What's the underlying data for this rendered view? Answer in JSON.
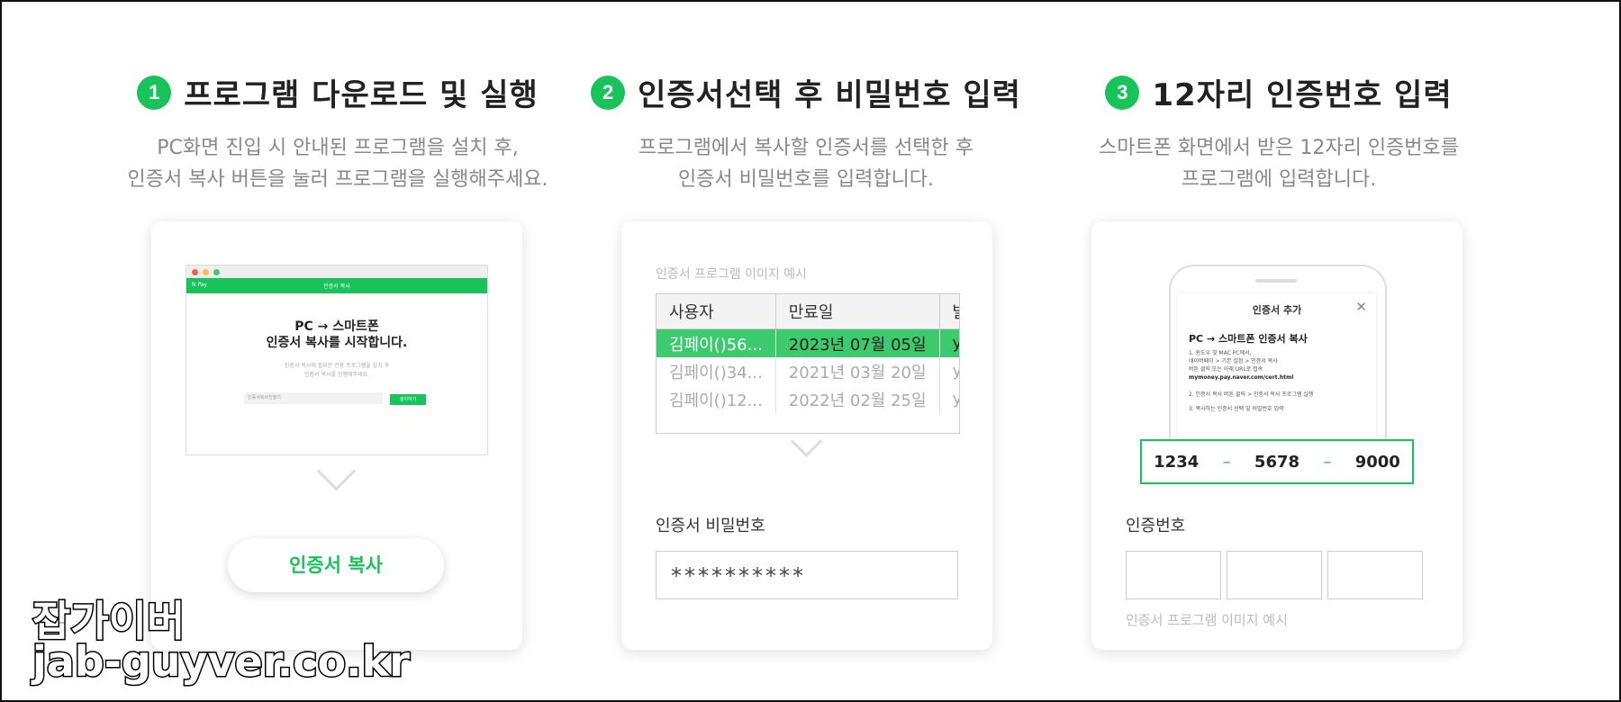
{
  "steps": [
    {
      "num": "1",
      "title": "프로그램 다운로드 및 실행",
      "desc1": "PC화면 진입 시 안내된 프로그램을 설치 후,",
      "desc2": "인증서 복사 버튼을 눌러 프로그램을 실행해주세요."
    },
    {
      "num": "2",
      "title": "인증서선택 후 비밀번호 입력",
      "desc1": "프로그램에서 복사할 인증서를 선택한 후",
      "desc2": "인증서 비밀번호를 입력합니다."
    },
    {
      "num": "3",
      "title": "12자리 인증번호 입력",
      "desc1": "스마트폰 화면에서 받은 12자리 인증번호를",
      "desc2": "프로그램에 입력합니다."
    }
  ],
  "card1": {
    "browser_logo": "N Pay",
    "browser_title": "인증서 복사",
    "headline1": "PC → 스마트폰",
    "headline2": "인증서 복사를 시작합니다.",
    "small1": "인증서 복사에 필요한 전용 프로그램을 설치 후",
    "small2": "인증서 복사를 진행해주세요.",
    "input_placeholder": "인증서복사진행기",
    "small_btn": "설치하기",
    "copy_button": "인증서 복사"
  },
  "card2": {
    "label": "인증서 프로그램 이미지 예시",
    "columns": [
      "사용자",
      "만료일",
      "발급"
    ],
    "rows": [
      [
        "김페이()56...",
        "2023년 07월 05일",
        "yes"
      ],
      [
        "김페이()34...",
        "2021년 03월 20일",
        "yes"
      ],
      [
        "김페이()12...",
        "2022년 02월 25일",
        "yes"
      ]
    ],
    "password_label": "인증서 비밀번호",
    "password_value": "**********"
  },
  "card3": {
    "screen_title": "인증서 추가",
    "close": "✕",
    "screen_head": "PC → 스마트폰 인증서 복사",
    "step1a": "1. 윈도우 및 MAC PC에서,",
    "step1b": "네이버페이 > 기본 설정 > 인증서 복사",
    "step1c": "버튼 클릭 또는 아래 URL로 접속",
    "step1url": "mymoney.pay.naver.com/cert.html",
    "step2": "2. 인증서 복사 버튼 클릭 > 인증서 복사 프로그램 실행",
    "step3": "3. 복사하는 인증서 선택 및 비밀번호 입력",
    "code": [
      "1234",
      "5678",
      "9000"
    ],
    "dash": "–",
    "auth_label": "인증번호",
    "caption": "인증서 프로그램 이미지 예시"
  },
  "watermark": {
    "line1": "잡가이버",
    "line2": "jab-guyver.co.kr"
  },
  "colors": {
    "accent": "#19c25a"
  }
}
